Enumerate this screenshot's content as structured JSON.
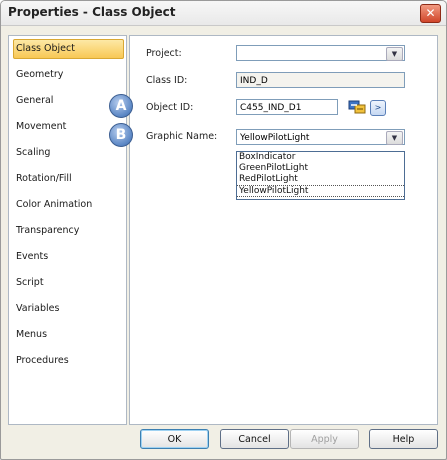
{
  "window": {
    "title": "Properties - Class Object",
    "close_glyph": "✕"
  },
  "sidebar": {
    "items": [
      {
        "label": "Class Object",
        "selected": true
      },
      {
        "label": "Geometry"
      },
      {
        "label": "General"
      },
      {
        "label": "Movement"
      },
      {
        "label": "Scaling"
      },
      {
        "label": "Rotation/Fill"
      },
      {
        "label": "Color Animation"
      },
      {
        "label": "Transparency"
      },
      {
        "label": "Events"
      },
      {
        "label": "Script"
      },
      {
        "label": "Variables"
      },
      {
        "label": "Menus"
      },
      {
        "label": "Procedures"
      }
    ]
  },
  "form": {
    "project_label": "Project:",
    "project_value": "",
    "class_id_label": "Class ID:",
    "class_id_value": "IND_D",
    "object_id_label": "Object ID:",
    "object_id_value": "C455_IND_D1",
    "graphic_name_label": "Graphic Name:",
    "graphic_name_value": "YellowPilotLight",
    "graphic_options": [
      "BoxIndicator",
      "GreenPilotLight",
      "RedPilotLight",
      "YellowPilotLight"
    ],
    "nav_glyph": ">",
    "dropdown_glyph": "▼"
  },
  "callouts": {
    "a": "A",
    "b": "B"
  },
  "buttons": {
    "ok": "OK",
    "cancel": "Cancel",
    "apply": "Apply",
    "help": "Help"
  },
  "colors": {
    "callout": "#5a86c4",
    "selection": "#f8c855",
    "close": "#d0462a"
  }
}
